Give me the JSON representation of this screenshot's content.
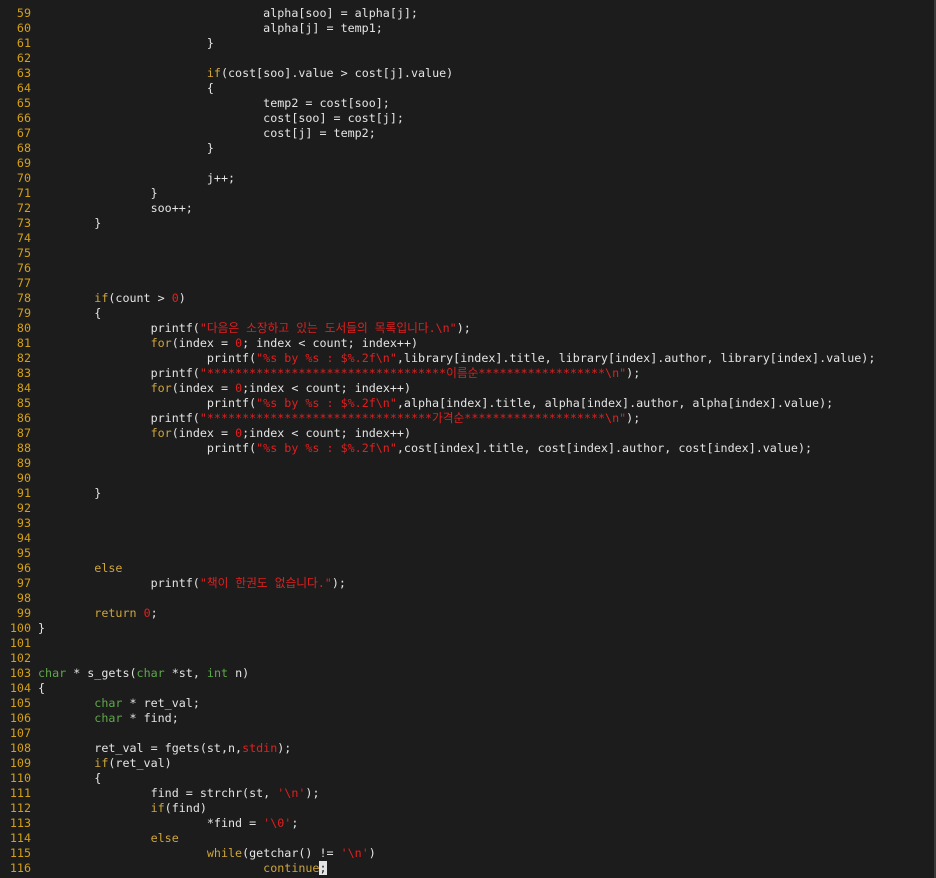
{
  "editor": {
    "theme_colors": {
      "background": "#1c1c1c",
      "text": "#e4e4e4",
      "line_number": "#d4a017",
      "keyword": "#cfa53a",
      "type": "#5fa84a",
      "string": "#e02020"
    },
    "lines": [
      {
        "n": "59",
        "segs": [
          {
            "t": "                                alpha[soo] = alpha[j];"
          }
        ]
      },
      {
        "n": "60",
        "segs": [
          {
            "t": "                                alpha[j] = temp1;"
          }
        ]
      },
      {
        "n": "61",
        "segs": [
          {
            "t": "                        }"
          }
        ]
      },
      {
        "n": "62",
        "segs": []
      },
      {
        "n": "63",
        "segs": [
          {
            "t": "                        "
          },
          {
            "t": "if",
            "c": "kw"
          },
          {
            "t": "(cost[soo].value > cost[j].value)"
          }
        ]
      },
      {
        "n": "64",
        "segs": [
          {
            "t": "                        {"
          }
        ]
      },
      {
        "n": "65",
        "segs": [
          {
            "t": "                                temp2 = cost[soo];"
          }
        ]
      },
      {
        "n": "66",
        "segs": [
          {
            "t": "                                cost[soo] = cost[j];"
          }
        ]
      },
      {
        "n": "67",
        "segs": [
          {
            "t": "                                cost[j] = temp2;"
          }
        ]
      },
      {
        "n": "68",
        "segs": [
          {
            "t": "                        }"
          }
        ]
      },
      {
        "n": "69",
        "segs": []
      },
      {
        "n": "70",
        "segs": [
          {
            "t": "                        j++;"
          }
        ]
      },
      {
        "n": "71",
        "segs": [
          {
            "t": "                }"
          }
        ]
      },
      {
        "n": "72",
        "segs": [
          {
            "t": "                soo++;"
          }
        ]
      },
      {
        "n": "73",
        "segs": [
          {
            "t": "        }"
          }
        ]
      },
      {
        "n": "74",
        "segs": []
      },
      {
        "n": "75",
        "segs": []
      },
      {
        "n": "76",
        "segs": []
      },
      {
        "n": "77",
        "segs": []
      },
      {
        "n": "78",
        "segs": [
          {
            "t": "        "
          },
          {
            "t": "if",
            "c": "kw"
          },
          {
            "t": "(count > "
          },
          {
            "t": "0",
            "c": "num"
          },
          {
            "t": ")"
          }
        ]
      },
      {
        "n": "79",
        "segs": [
          {
            "t": "        {"
          }
        ]
      },
      {
        "n": "80",
        "segs": [
          {
            "t": "                printf("
          },
          {
            "t": "\"다음은 소장하고 있는 도서들의 목록입니다.\\n\"",
            "c": "str"
          },
          {
            "t": ");"
          }
        ]
      },
      {
        "n": "81",
        "segs": [
          {
            "t": "                "
          },
          {
            "t": "for",
            "c": "kw"
          },
          {
            "t": "(index = "
          },
          {
            "t": "0",
            "c": "num"
          },
          {
            "t": "; index < count; index++)"
          }
        ]
      },
      {
        "n": "82",
        "segs": [
          {
            "t": "                        printf("
          },
          {
            "t": "\"%s by %s : $%.2f\\n\"",
            "c": "str"
          },
          {
            "t": ",library[index].title, library[index].author, library[index].value);"
          }
        ]
      },
      {
        "n": "83",
        "segs": [
          {
            "t": "                printf("
          },
          {
            "t": "\"**********************************이름순******************\\n\"",
            "c": "str"
          },
          {
            "t": ");"
          }
        ]
      },
      {
        "n": "84",
        "segs": [
          {
            "t": "                "
          },
          {
            "t": "for",
            "c": "kw"
          },
          {
            "t": "(index = "
          },
          {
            "t": "0",
            "c": "num"
          },
          {
            "t": ";index < count; index++)"
          }
        ]
      },
      {
        "n": "85",
        "segs": [
          {
            "t": "                        printf("
          },
          {
            "t": "\"%s by %s : $%.2f\\n\"",
            "c": "str"
          },
          {
            "t": ",alpha[index].title, alpha[index].author, alpha[index].value);"
          }
        ]
      },
      {
        "n": "86",
        "segs": [
          {
            "t": "                printf("
          },
          {
            "t": "\"********************************가격순********************\\n\"",
            "c": "str"
          },
          {
            "t": ");"
          }
        ]
      },
      {
        "n": "87",
        "segs": [
          {
            "t": "                "
          },
          {
            "t": "for",
            "c": "kw"
          },
          {
            "t": "(index = "
          },
          {
            "t": "0",
            "c": "num"
          },
          {
            "t": ";index < count; index++)"
          }
        ]
      },
      {
        "n": "88",
        "segs": [
          {
            "t": "                        printf("
          },
          {
            "t": "\"%s by %s : $%.2f\\n\"",
            "c": "str"
          },
          {
            "t": ",cost[index].title, cost[index].author, cost[index].value);"
          }
        ]
      },
      {
        "n": "89",
        "segs": []
      },
      {
        "n": "90",
        "segs": []
      },
      {
        "n": "91",
        "segs": [
          {
            "t": "        }"
          }
        ]
      },
      {
        "n": "92",
        "segs": []
      },
      {
        "n": "93",
        "segs": []
      },
      {
        "n": "94",
        "segs": []
      },
      {
        "n": "95",
        "segs": []
      },
      {
        "n": "96",
        "segs": [
          {
            "t": "        "
          },
          {
            "t": "else",
            "c": "kw"
          }
        ]
      },
      {
        "n": "97",
        "segs": [
          {
            "t": "                printf("
          },
          {
            "t": "\"책이 한권도 없습니다.\"",
            "c": "str"
          },
          {
            "t": ");"
          }
        ]
      },
      {
        "n": "98",
        "segs": []
      },
      {
        "n": "99",
        "segs": [
          {
            "t": "        "
          },
          {
            "t": "return",
            "c": "kw"
          },
          {
            "t": " "
          },
          {
            "t": "0",
            "c": "num"
          },
          {
            "t": ";"
          }
        ]
      },
      {
        "n": "100",
        "segs": [
          {
            "t": "}"
          }
        ]
      },
      {
        "n": "101",
        "segs": []
      },
      {
        "n": "102",
        "segs": []
      },
      {
        "n": "103",
        "segs": [
          {
            "t": "char",
            "c": "ty"
          },
          {
            "t": " * s_gets("
          },
          {
            "t": "char",
            "c": "ty"
          },
          {
            "t": " *st, "
          },
          {
            "t": "int",
            "c": "ty"
          },
          {
            "t": " n)"
          }
        ]
      },
      {
        "n": "104",
        "segs": [
          {
            "t": "{"
          }
        ]
      },
      {
        "n": "105",
        "segs": [
          {
            "t": "        "
          },
          {
            "t": "char",
            "c": "ty"
          },
          {
            "t": " * ret_val;"
          }
        ]
      },
      {
        "n": "106",
        "segs": [
          {
            "t": "        "
          },
          {
            "t": "char",
            "c": "ty"
          },
          {
            "t": " * find;"
          }
        ]
      },
      {
        "n": "107",
        "segs": []
      },
      {
        "n": "108",
        "segs": [
          {
            "t": "        ret_val = fgets(st,n,"
          },
          {
            "t": "stdin",
            "c": "std"
          },
          {
            "t": ");"
          }
        ]
      },
      {
        "n": "109",
        "segs": [
          {
            "t": "        "
          },
          {
            "t": "if",
            "c": "kw"
          },
          {
            "t": "(ret_val)"
          }
        ]
      },
      {
        "n": "110",
        "segs": [
          {
            "t": "        {"
          }
        ]
      },
      {
        "n": "111",
        "segs": [
          {
            "t": "                find = strchr(st, "
          },
          {
            "t": "'\\n'",
            "c": "str"
          },
          {
            "t": ");"
          }
        ]
      },
      {
        "n": "112",
        "segs": [
          {
            "t": "                "
          },
          {
            "t": "if",
            "c": "kw"
          },
          {
            "t": "(find)"
          }
        ]
      },
      {
        "n": "113",
        "segs": [
          {
            "t": "                        *find = "
          },
          {
            "t": "'\\0'",
            "c": "str"
          },
          {
            "t": ";"
          }
        ]
      },
      {
        "n": "114",
        "segs": [
          {
            "t": "                "
          },
          {
            "t": "else",
            "c": "kw"
          }
        ]
      },
      {
        "n": "115",
        "segs": [
          {
            "t": "                        "
          },
          {
            "t": "while",
            "c": "kw"
          },
          {
            "t": "(getchar() != "
          },
          {
            "t": "'\\n'",
            "c": "str"
          },
          {
            "t": ")"
          }
        ]
      },
      {
        "n": "116",
        "segs": [
          {
            "t": "                                "
          },
          {
            "t": "continue",
            "c": "kw"
          },
          {
            "t": ";",
            "c": "cursor"
          }
        ]
      }
    ]
  }
}
